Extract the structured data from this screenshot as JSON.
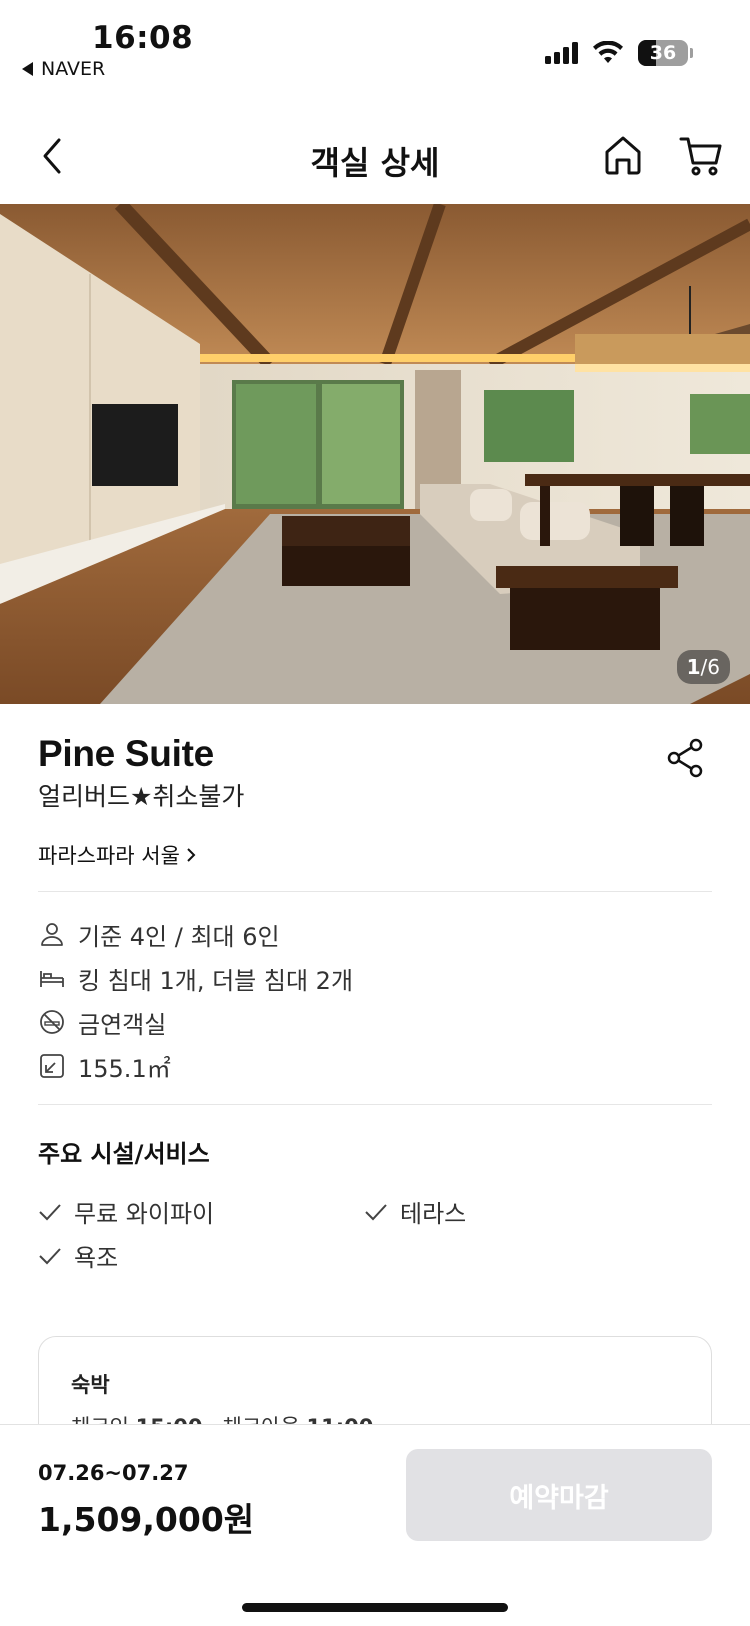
{
  "status_bar": {
    "time": "16:08",
    "back_app": "NAVER",
    "battery": "36",
    "battery_level": 0.36,
    "icons": [
      "signal-icon",
      "wifi-icon",
      "battery-icon"
    ]
  },
  "nav": {
    "title": "객실 상세",
    "back_icon": "chevron-left-icon",
    "home_icon": "home-icon",
    "cart_icon": "cart-icon"
  },
  "hero": {
    "counter_current": "1",
    "counter_total": "/6",
    "total_photos": 6
  },
  "room": {
    "name": "Pine Suite",
    "plan": "얼리버드★취소불가",
    "property_link": "파라스파라 서울",
    "share_icon": "share-icon"
  },
  "specs": [
    {
      "icon": "person-icon",
      "text": "기준 4인 / 최대 6인"
    },
    {
      "icon": "bed-icon",
      "text": "킹 침대 1개, 더블 침대 2개"
    },
    {
      "icon": "no-smoking-icon",
      "text": "금연객실"
    },
    {
      "icon": "area-icon",
      "text": "155.1㎡"
    }
  ],
  "amenities": {
    "title": "주요 시설/서비스",
    "items": [
      "무료 와이파이",
      "테라스",
      "욕조"
    ]
  },
  "stay": {
    "label": "숙박",
    "checkin_label": "체크인",
    "checkin_time": "15:00",
    "separator": " · ",
    "checkout_label": "체크아웃",
    "checkout_time": "11:00"
  },
  "booking": {
    "dates": "07.26~07.27",
    "price": "1,509,000원",
    "button_label": "예약마감"
  },
  "colors": {
    "button_disabled": "#e1e1e4",
    "divider": "#e6e6e6",
    "text_primary": "#111111"
  }
}
